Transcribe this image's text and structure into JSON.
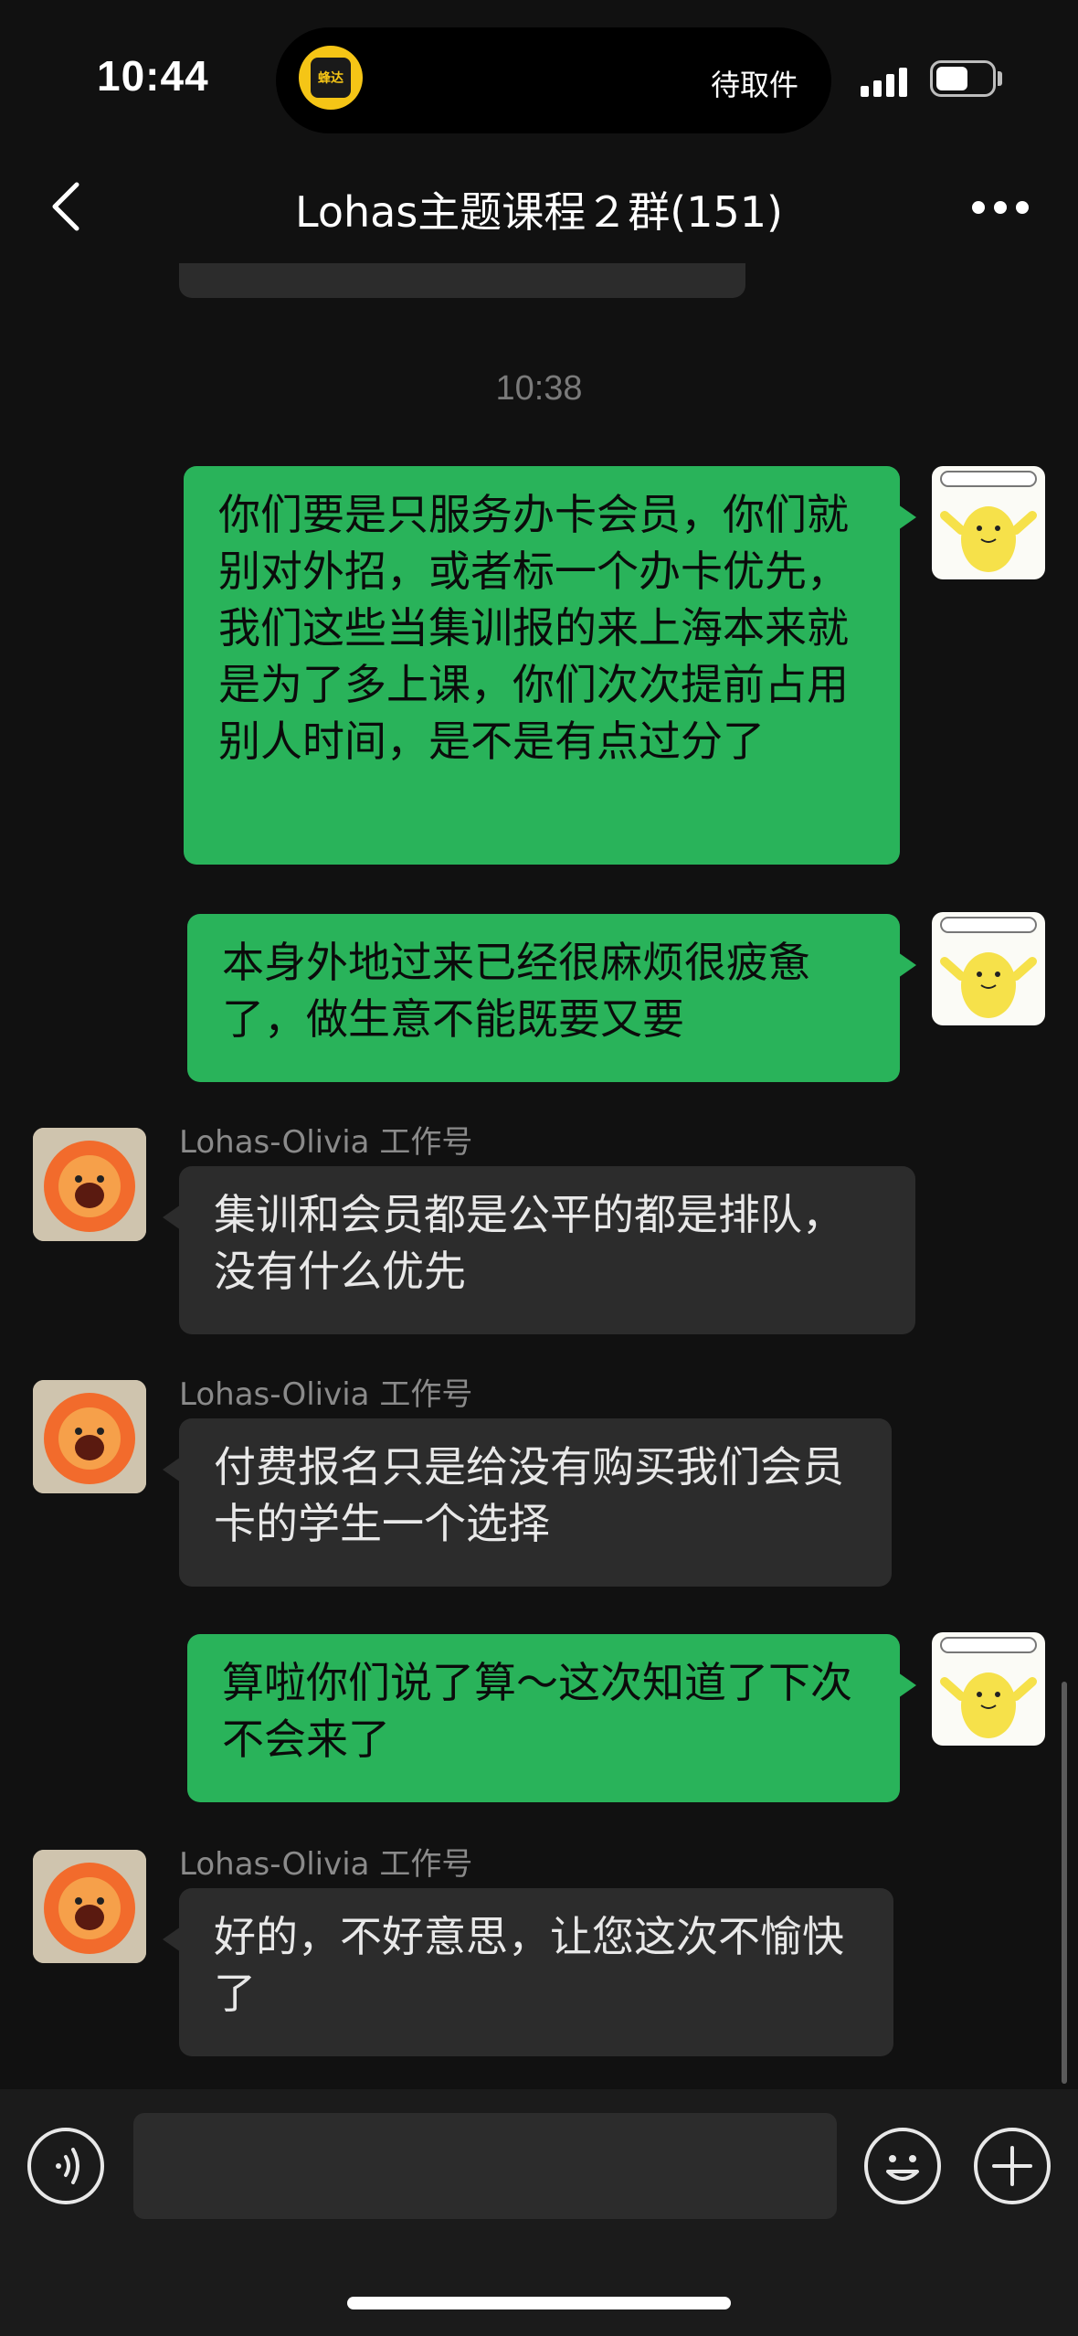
{
  "status_bar": {
    "time": "10:44",
    "island_app": "蜂达",
    "island_status": "待取件"
  },
  "header": {
    "title": "Lohas主题课程２群(151)"
  },
  "timestamp": "10:38",
  "messages": [
    {
      "sender": "",
      "text": "你们要是只服务办卡会员，你们就别对外招，或者标一个办卡优先，我们这些当集训报的来上海本来就是为了多上课，你们次次提前占用别人时间，是不是有点过分了"
    },
    {
      "sender": "",
      "text": "本身外地过来已经很麻烦很疲惫了，做生意不能既要又要"
    },
    {
      "sender": "Lohas-Olivia 工作号",
      "text": "集训和会员都是公平的都是排队，没有什么优先"
    },
    {
      "sender": "Lohas-Olivia 工作号",
      "text": "付费报名只是给没有购买我们会员卡的学生一个选择"
    },
    {
      "sender": "",
      "text": "算啦你们说了算～这次知道了下次不会来了"
    },
    {
      "sender": "Lohas-Olivia 工作号",
      "text": "好的，不好意思，让您这次不愉快了"
    }
  ],
  "colors": {
    "my_bubble": "#29b35a",
    "other_bubble": "#2c2c2c",
    "background": "#111111"
  },
  "icons": [
    "chevron-left-icon",
    "more-icon",
    "voice-icon",
    "emoji-icon",
    "plus-icon"
  ]
}
